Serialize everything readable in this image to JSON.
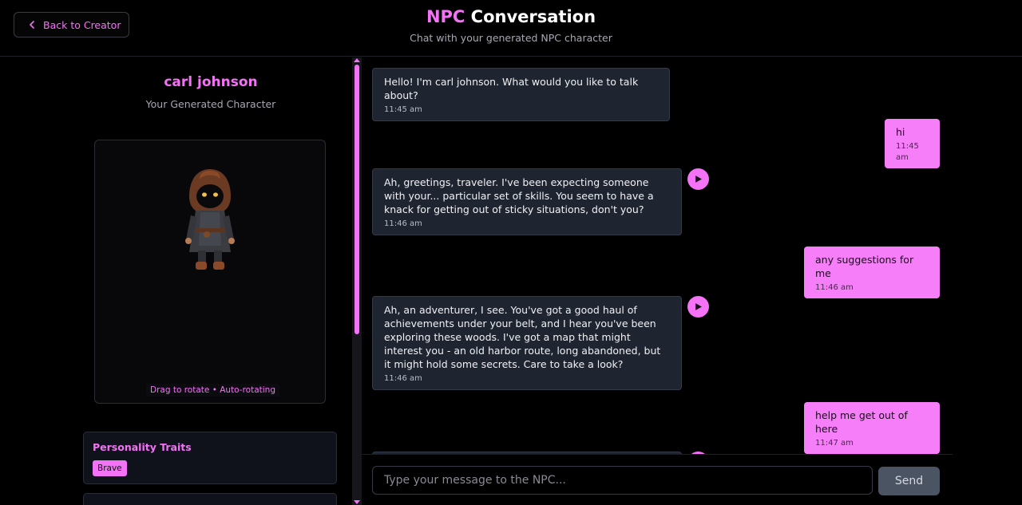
{
  "header": {
    "back_label": "Back to Creator",
    "title_accent": "NPC",
    "title_rest": " Conversation",
    "subtitle": "Chat with your generated NPC character"
  },
  "character": {
    "name": "carl johnson",
    "subtitle": "Your Generated Character",
    "viewer_hint": "Drag to rotate • Auto-rotating"
  },
  "traits": {
    "title": "Personality Traits",
    "items": [
      "Brave"
    ]
  },
  "messages": [
    {
      "role": "npc",
      "text": "Hello! I'm carl johnson. What would you like to talk about?",
      "time": "11:45 am"
    },
    {
      "role": "user",
      "text": "hi",
      "time": "11:45 am"
    },
    {
      "role": "npc",
      "text": "Ah, greetings, traveler. I've been expecting someone with your... particular set of skills. You seem to have a knack for getting out of sticky situations, don't you?",
      "time": "11:46 am"
    },
    {
      "role": "user",
      "text": "any suggestions for me",
      "time": "11:46 am"
    },
    {
      "role": "npc",
      "text": "Ah, an adventurer, I see. You've got a good haul of achievements under your belt, and I hear you've been exploring these woods. I've got a map that might interest you - an old harbor route, long abandoned, but it might hold some secrets. Care to take a look?",
      "time": "11:46 am"
    },
    {
      "role": "user",
      "text": "help me get out of here",
      "time": "11:47 am"
    }
  ],
  "composer": {
    "placeholder": "Type your message to the NPC...",
    "send_label": "Send"
  },
  "colors": {
    "accent": "#f472f6",
    "background": "#000000",
    "npc_bubble": "#1f2530"
  }
}
